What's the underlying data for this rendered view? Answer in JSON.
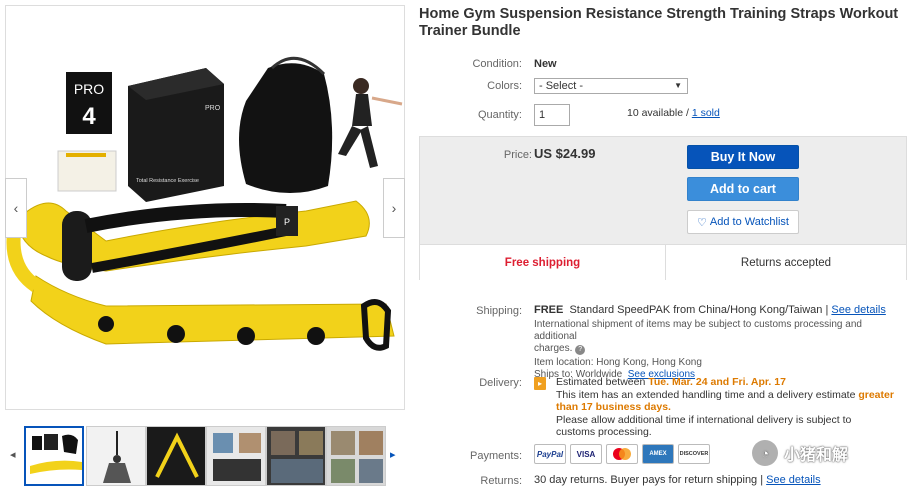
{
  "listing": {
    "title": "Home Gym Suspension Resistance Strength Training Straps Workout Trainer Bundle"
  },
  "gallery": {
    "box_label_top": "PRO",
    "box_label_num": "4",
    "box_caption": "Total Resistance Exercise",
    "box_brand": "PRO",
    "strap_label": "P",
    "prev_arrow": "‹",
    "next_arrow": "›",
    "thumb_prev": "◂",
    "thumb_next": "▸"
  },
  "fields": {
    "condition_label": "Condition:",
    "condition_value": "New",
    "colors_label": "Colors:",
    "colors_selected": "- Select -",
    "quantity_label": "Quantity:",
    "quantity_value": "1",
    "available_text": "10 available /",
    "sold_link": "1 sold"
  },
  "buybox": {
    "price_label": "Price:",
    "price_value": "US $24.99",
    "buy_now": "Buy It Now",
    "add_to_cart": "Add to cart",
    "watchlist": "Add to Watchlist",
    "free_shipping": "Free shipping",
    "returns_accepted": "Returns accepted"
  },
  "shipping": {
    "label": "Shipping:",
    "free": "FREE",
    "method": "Standard SpeedPAK from China/Hong Kong/Taiwan |",
    "see_details": "See details",
    "intl_note": "International shipment of items may be subject to customs processing and additional",
    "intl_note2": "charges.",
    "location": "Item location:  Hong Kong, Hong Kong",
    "ships_to": "Ships to:  Worldwide",
    "see_exclusions": "See exclusions"
  },
  "delivery": {
    "label": "Delivery:",
    "estimated_prefix": "Estimated between",
    "dates": "Tue. Mar. 24 and Fri. Apr. 17",
    "handling_line1": "This item has an extended handling time and a delivery estimate",
    "handling_greater": "greater",
    "handling_line2": "than 17 business days.",
    "customs_line1": "Please allow additional time if international delivery is subject to",
    "customs_line2": "customs processing."
  },
  "payments": {
    "label": "Payments:",
    "logos": [
      "PayPal",
      "VISA",
      "MasterCard",
      "AMEX",
      "DISCOVER"
    ]
  },
  "returns": {
    "label": "Returns:",
    "text": "30 day returns. Buyer pays for return shipping |",
    "see_details": "See details"
  },
  "watermark": {
    "text": "小猪和解"
  },
  "colors": {
    "link": "#0654ba",
    "buy_now": "#0654ba",
    "add_to_cart": "#3b8edb",
    "free_shipping": "#dd1e31",
    "date_highlight": "#dd7a00",
    "strap_yellow": "#f2d21a"
  }
}
